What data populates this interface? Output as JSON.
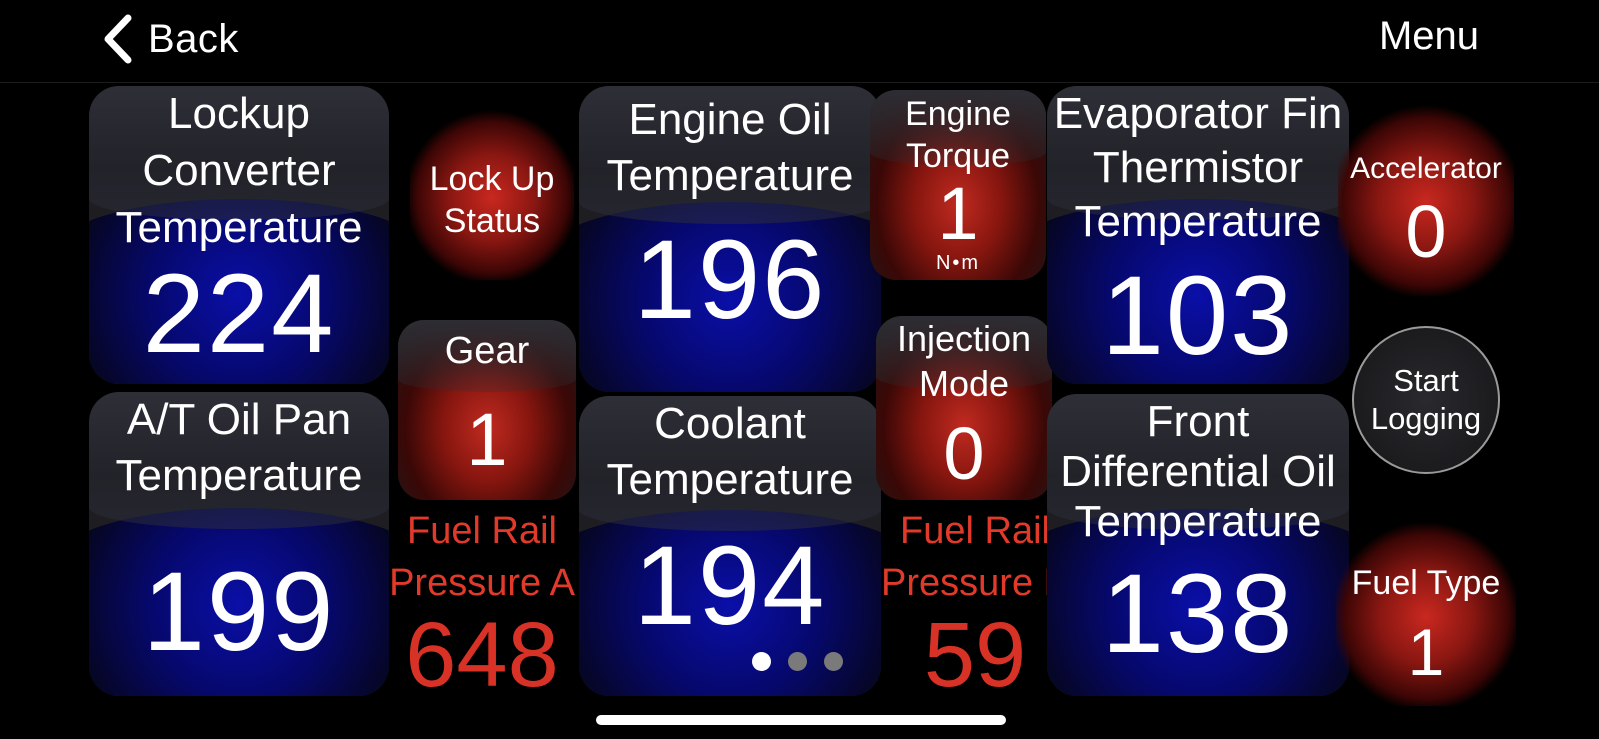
{
  "nav": {
    "back_label": "Back",
    "menu_label": "Menu"
  },
  "gauges": {
    "lockup_converter": {
      "title": [
        "Lockup",
        "Converter",
        "Temperature"
      ],
      "value": "224"
    },
    "at_oil_pan": {
      "title": [
        "A/T Oil Pan",
        "Temperature"
      ],
      "value": "199"
    },
    "lock_up_status": {
      "title": [
        "Lock Up",
        "Status"
      ]
    },
    "gear": {
      "title": "Gear",
      "value": "1"
    },
    "fuel_rail_a": {
      "title": [
        "Fuel Rail",
        "Pressure A"
      ],
      "value": "648"
    },
    "engine_oil": {
      "title": [
        "Engine Oil",
        "Temperature"
      ],
      "value": "196"
    },
    "coolant": {
      "title": [
        "Coolant",
        "Temperature"
      ],
      "value": "194"
    },
    "engine_torque": {
      "title": [
        "Engine",
        "Torque"
      ],
      "value": "1",
      "unit": "N•m"
    },
    "injection_mode": {
      "title": [
        "Injection",
        "Mode"
      ],
      "value": "0"
    },
    "fuel_rail_b": {
      "title": [
        "Fuel Rail",
        "Pressure B"
      ],
      "value": "59"
    },
    "evaporator_fin": {
      "title": [
        "Evaporator Fin",
        "Thermistor",
        "Temperature"
      ],
      "value": "103"
    },
    "front_diff_oil": {
      "title": [
        "Front",
        "Differential Oil",
        "Temperature"
      ],
      "value": "138"
    },
    "accelerator": {
      "title": "Accelerator",
      "value": "0"
    },
    "fuel_type": {
      "title": "Fuel Type",
      "value": "1"
    }
  },
  "start_logging": [
    "Start",
    "Logging"
  ],
  "pager": {
    "count": 3,
    "active_index": 0
  },
  "colors": {
    "background": "#000000",
    "tile_blue": "#0a0fa8",
    "gauge_red": "#c9281f",
    "red_text": "#e23a2a"
  }
}
